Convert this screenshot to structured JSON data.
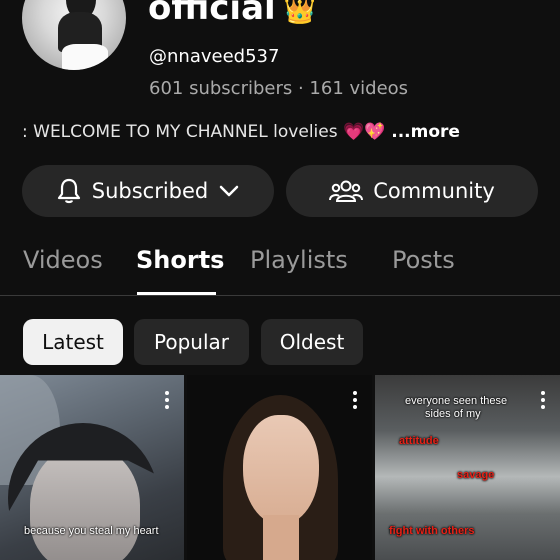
{
  "channel": {
    "title": "official",
    "crown": "👑",
    "handle": "@nnaveed537",
    "stats": "601 subscribers · 161 videos",
    "description": ": WELCOME TO MY CHANNEL lovelies 💗💖",
    "more": " ...more"
  },
  "actions": {
    "subscribed_label": "Subscribed",
    "community_label": "Community"
  },
  "tabs": [
    {
      "label": "Videos"
    },
    {
      "label": "Shorts",
      "active": true
    },
    {
      "label": "Playlists"
    },
    {
      "label": "Posts"
    }
  ],
  "filters": [
    {
      "label": "Latest",
      "selected": true
    },
    {
      "label": "Popular"
    },
    {
      "label": "Oldest"
    }
  ],
  "shorts": [
    {
      "captions": [
        "because you steal my heart"
      ]
    },
    {
      "captions": []
    },
    {
      "captions": [
        "everyone seen these",
        "sides of my",
        "attitude",
        "savage",
        "fight with others"
      ]
    }
  ],
  "colors": {
    "background": "#0f0f0f",
    "button": "#272727",
    "muted_text": "#aaaaaa",
    "caption_red": "#e62117"
  }
}
